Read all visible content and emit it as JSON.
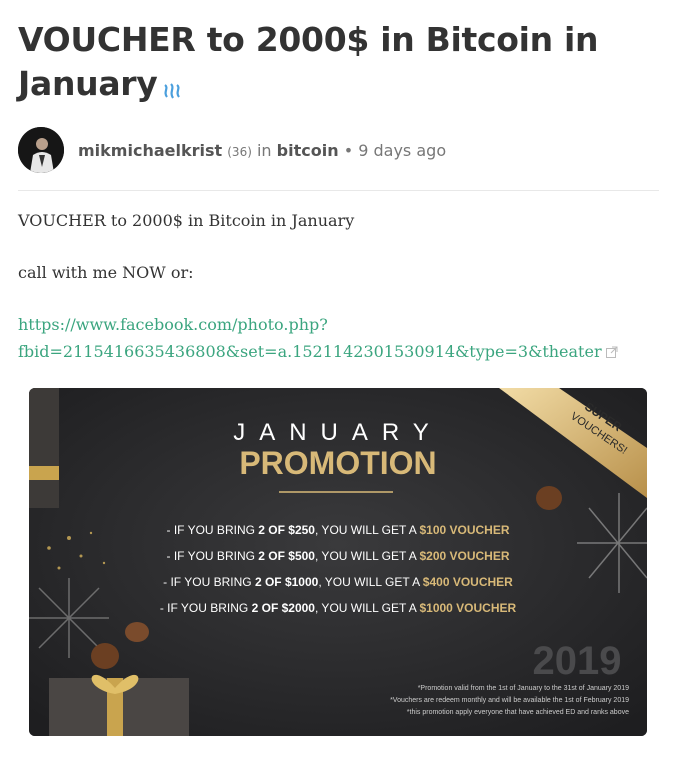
{
  "post": {
    "title": "VOUCHER to 2000$ in Bitcoin in January",
    "author": "mikmichaelkrist",
    "reputation": "(36)",
    "in_label": "in",
    "category": "bitcoin",
    "separator": "•",
    "time_ago": "9 days ago",
    "body_line1": "VOUCHER to 2000$ in Bitcoin in January",
    "body_line2": "call with me NOW or:",
    "link_line1": "https://www.facebook.com/photo.php?",
    "link_line2": "fbid=2115416635436808&set=a.1521142301530914&type=3&theater",
    "link_color": "#3ba57f"
  },
  "promo": {
    "heading1": "JANUARY",
    "heading2": "PROMOTION",
    "ribbon_line1": "SUPER",
    "ribbon_line2": "VOUCHERS!",
    "offers": [
      {
        "prefix": "- IF YOU BRING ",
        "bring": "2 OF $250",
        "mid": ", YOU WILL GET A ",
        "get": "$100 VOUCHER"
      },
      {
        "prefix": "- IF YOU BRING ",
        "bring": "2 OF $500",
        "mid": ", YOU WILL GET A ",
        "get": "$200 VOUCHER"
      },
      {
        "prefix": "- IF YOU BRING ",
        "bring": "2 OF $1000",
        "mid": ", YOU WILL GET A ",
        "get": "$400 VOUCHER"
      },
      {
        "prefix": "- IF YOU BRING ",
        "bring": "2 OF $2000",
        "mid": ", YOU WILL GET A ",
        "get": "$1000 VOUCHER"
      }
    ],
    "year": "2019",
    "footnote1": "*Promotion valid from the 1st of January to the 31st of January 2019",
    "footnote2": "*Vouchers are redeem monthly and will be available the 1st of February 2019",
    "footnote3": "*this promotion apply everyone that have achieved ED and ranks above",
    "gold_color": "#d8b978"
  }
}
